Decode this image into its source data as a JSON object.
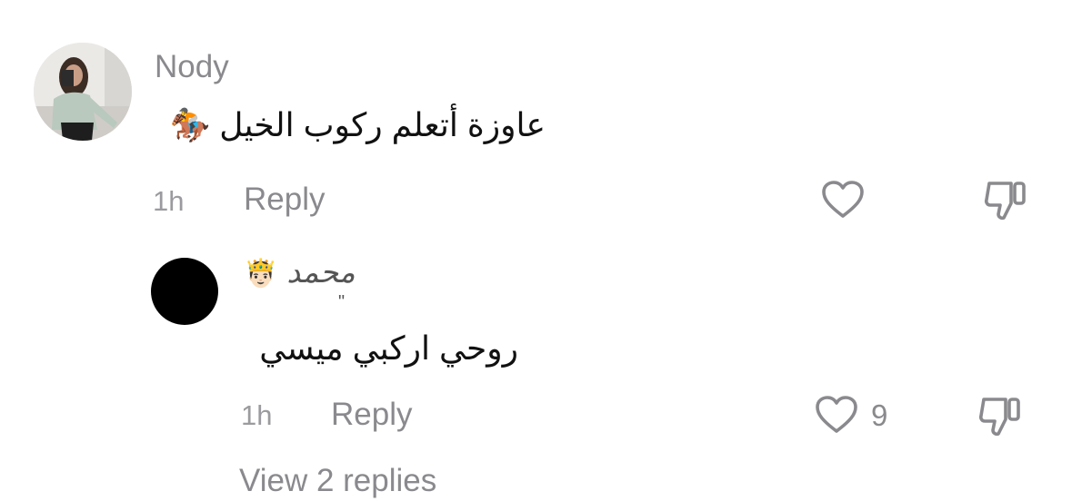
{
  "comments": [
    {
      "username": "Nody",
      "text": "عاوزة أتعلم ركوب الخيل 🏇",
      "time": "1h",
      "reply_label": "Reply"
    }
  ],
  "reply": {
    "username_emoji": "🤴🏻",
    "username": "محمد",
    "mark": "\"",
    "text": "روحي اركبي ميسي",
    "time": "1h",
    "reply_label": "Reply",
    "like_count": "9"
  },
  "view_replies_label": "View 2 replies",
  "icons": {
    "like": "heart-icon",
    "dislike": "thumbs-down-icon"
  },
  "colors": {
    "text_primary": "#111111",
    "text_secondary": "#8a8a8e",
    "avatar_reply": "#000000"
  }
}
